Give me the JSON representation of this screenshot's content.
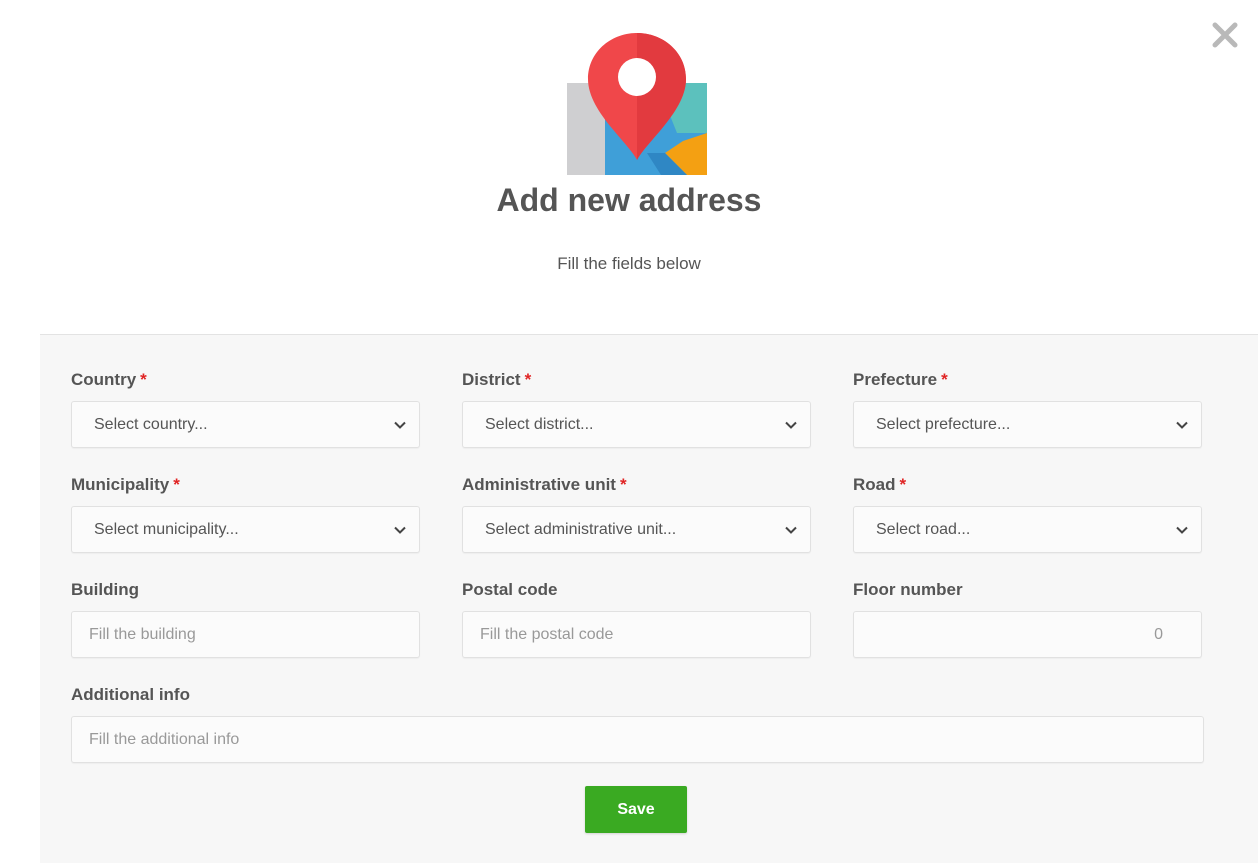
{
  "dialog": {
    "title": "Add new address",
    "subtitle": "Fill the fields below",
    "close_icon": "close-icon",
    "hero_icon": "map-location-icon"
  },
  "form": {
    "country": {
      "label": "Country",
      "required_mark": "*",
      "value": "Select country..."
    },
    "district": {
      "label": "District",
      "required_mark": "*",
      "value": "Select district..."
    },
    "prefecture": {
      "label": "Prefecture",
      "required_mark": "*",
      "value": "Select prefecture..."
    },
    "municipality": {
      "label": "Municipality",
      "required_mark": "*",
      "value": "Select municipality..."
    },
    "administrative_unit": {
      "label": "Administrative unit",
      "required_mark": "*",
      "value": "Select administrative unit..."
    },
    "road": {
      "label": "Road",
      "required_mark": "*",
      "value": "Select road..."
    },
    "building": {
      "label": "Building",
      "placeholder": "Fill the building",
      "value": ""
    },
    "postal_code": {
      "label": "Postal code",
      "placeholder": "Fill the postal code",
      "value": ""
    },
    "floor_number": {
      "label": "Floor number",
      "placeholder": "0",
      "value": ""
    },
    "additional_info": {
      "label": "Additional info",
      "placeholder": "Fill the additional info",
      "value": ""
    },
    "save_label": "Save"
  },
  "colors": {
    "save_button": "#3aaa22",
    "required_mark": "#e02424",
    "pin_red": "#f0474a",
    "map_teal": "#5cc1bd",
    "map_blue": "#3f9fd8",
    "map_orange": "#f4a012",
    "map_gray": "#cfcfd1"
  }
}
